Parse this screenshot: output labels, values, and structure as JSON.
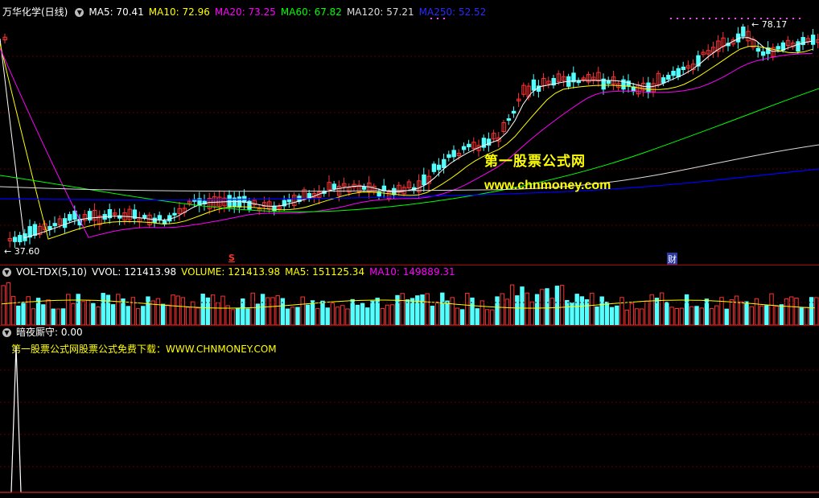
{
  "main_header": {
    "stock_title": "万华化学(日线)",
    "ma5": "MA5: 70.41",
    "ma10": "MA10: 72.96",
    "ma20": "MA20: 73.25",
    "ma60": "MA60: 67.82",
    "ma120": "MA120: 57.21",
    "ma250": "MA250: 52.52"
  },
  "price_labels": {
    "high": "78.17",
    "low": "37.60"
  },
  "event_marks": {
    "s_mark": "S",
    "cai_mark": "财"
  },
  "watermark": {
    "title": "第一股票公式网",
    "url": "www.chnmoney.com"
  },
  "vol_header": {
    "name": "VOL-TDX(5,10)",
    "vvol": "VVOL: 121413.98",
    "volume": "VOLUME: 121413.98",
    "ma5": "MA5: 151125.34",
    "ma10": "MA10: 149889.31"
  },
  "ind_header": {
    "name": "暗夜厮守",
    "value": ": 0.00"
  },
  "ind_note": "第一股票公式网股票公式免费下载：WWW.CHNMONEY.COM",
  "colors": {
    "up": "#ff3232",
    "down": "#54ffff",
    "ma5": "#ffffff",
    "ma10": "#ffff00",
    "ma20": "#ff00ff",
    "ma60": "#00ff00",
    "ma120": "#dcdcdc",
    "ma250": "#0000ff"
  }
}
